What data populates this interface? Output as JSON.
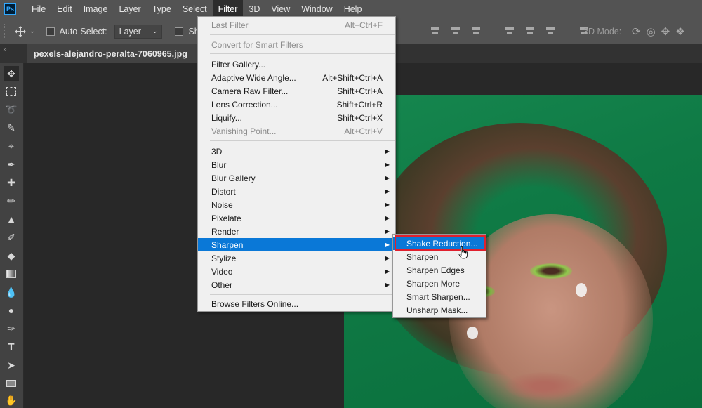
{
  "app": {
    "logo_text": "Ps"
  },
  "menubar": {
    "items": [
      "File",
      "Edit",
      "Image",
      "Layer",
      "Type",
      "Select",
      "Filter",
      "3D",
      "View",
      "Window",
      "Help"
    ],
    "active": "Filter"
  },
  "options": {
    "auto_select_label": "Auto-Select:",
    "layer_dropdown": "Layer",
    "show_label_partial": "Sh",
    "mode_3d_label": "3D Mode:"
  },
  "document": {
    "tab_title": "pexels-alejandro-peralta-7060965.jpg"
  },
  "filter_menu": {
    "last_filter": {
      "label": "Last Filter",
      "shortcut": "Alt+Ctrl+F"
    },
    "convert_smart": "Convert for Smart Filters",
    "group2": [
      {
        "label": "Filter Gallery...",
        "shortcut": ""
      },
      {
        "label": "Adaptive Wide Angle...",
        "shortcut": "Alt+Shift+Ctrl+A"
      },
      {
        "label": "Camera Raw Filter...",
        "shortcut": "Shift+Ctrl+A"
      },
      {
        "label": "Lens Correction...",
        "shortcut": "Shift+Ctrl+R"
      },
      {
        "label": "Liquify...",
        "shortcut": "Shift+Ctrl+X"
      },
      {
        "label": "Vanishing Point...",
        "shortcut": "Alt+Ctrl+V"
      }
    ],
    "submenus": [
      "3D",
      "Blur",
      "Blur Gallery",
      "Distort",
      "Noise",
      "Pixelate",
      "Render",
      "Sharpen",
      "Stylize",
      "Video",
      "Other"
    ],
    "highlighted": "Sharpen",
    "browse_online": "Browse Filters Online..."
  },
  "sharpen_submenu": {
    "items": [
      "Shake Reduction...",
      "Sharpen",
      "Sharpen Edges",
      "Sharpen More",
      "Smart Sharpen...",
      "Unsharp Mask..."
    ],
    "highlighted": "Shake Reduction..."
  },
  "colors": {
    "highlight": "#0a78d7",
    "callout_border": "#e0202e",
    "menubar_bg": "#535353",
    "menu_bg": "#f0f0f0"
  },
  "icons": [
    "move-tool-icon",
    "marquee-tool-icon",
    "lasso-tool-icon",
    "quick-select-tool-icon",
    "crop-tool-icon",
    "eyedropper-tool-icon",
    "healing-brush-icon",
    "brush-tool-icon",
    "clone-stamp-icon",
    "history-brush-icon",
    "eraser-tool-icon",
    "gradient-tool-icon",
    "blur-tool-icon",
    "dodge-tool-icon",
    "pen-tool-icon",
    "type-tool-icon",
    "path-select-icon",
    "rectangle-tool-icon",
    "hand-tool-icon"
  ]
}
